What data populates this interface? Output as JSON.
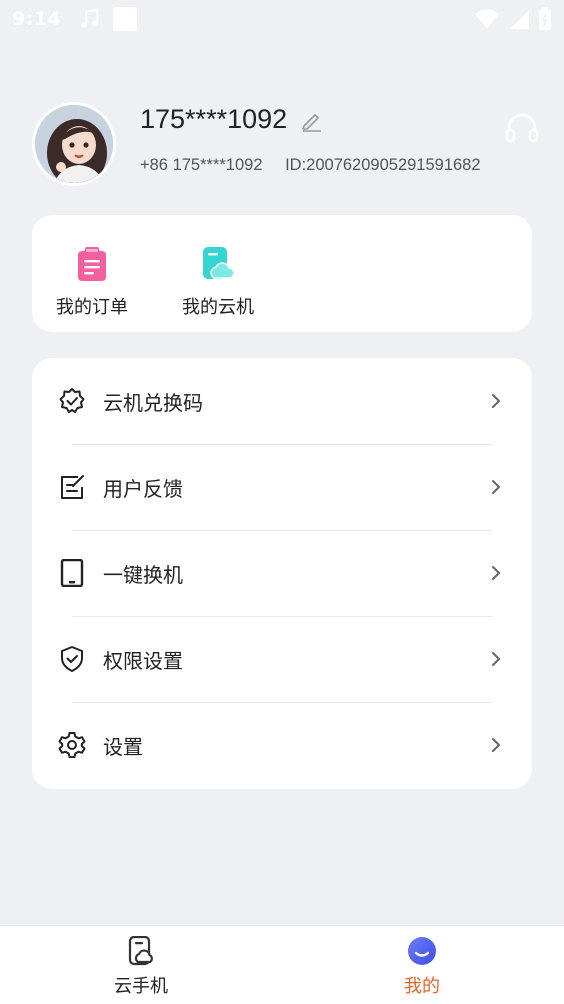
{
  "status_bar": {
    "time": "9:14",
    "icons": [
      "music-note-icon",
      "notification-square-icon",
      "wifi-icon",
      "signal-icon",
      "battery-icon"
    ]
  },
  "profile": {
    "username": "175****1092",
    "phone": "+86 175****1092",
    "id_text": "ID:2007620905291591682",
    "icons": [
      "avatar",
      "edit-icon",
      "headset-icon"
    ]
  },
  "quick_actions": [
    {
      "label": "我的订单",
      "icon": "order-clipboard-icon",
      "color": "#f45fa0"
    },
    {
      "label": "我的云机",
      "icon": "cloud-phone-icon",
      "color": "#35d6d1"
    }
  ],
  "menu": [
    {
      "label": "云机兑换码",
      "icon": "badge-check-icon"
    },
    {
      "label": "用户反馈",
      "icon": "feedback-edit-icon"
    },
    {
      "label": "一键换机",
      "icon": "phone-device-icon"
    },
    {
      "label": "权限设置",
      "icon": "shield-check-icon"
    },
    {
      "label": "设置",
      "icon": "gear-icon"
    }
  ],
  "bottom_nav": [
    {
      "label": "云手机",
      "icon": "cloud-phone-tab-icon",
      "active": false
    },
    {
      "label": "我的",
      "icon": "profile-smile-icon",
      "active": true
    }
  ],
  "colors": {
    "accent": "#e2662e",
    "background": "#eef0f4",
    "card": "#ffffff"
  }
}
